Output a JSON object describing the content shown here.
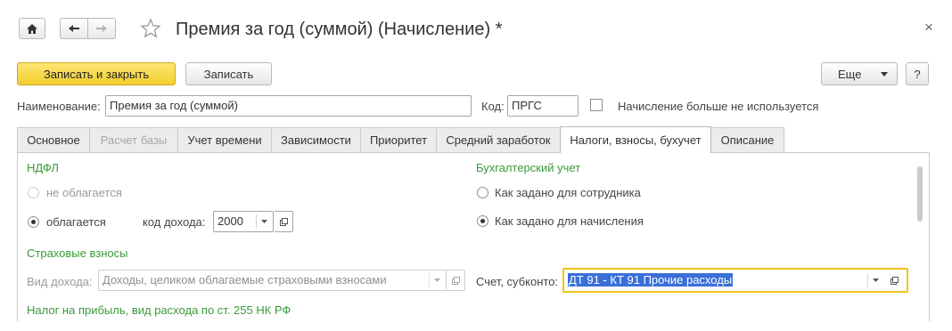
{
  "window": {
    "title": "Премия за год (суммой) (Начисление) *",
    "close_symbol": "×"
  },
  "toolbar": {
    "save_close_label": "Записать и закрыть",
    "save_label": "Записать",
    "more_label": "Еще",
    "help_label": "?"
  },
  "header": {
    "name_label": "Наименование:",
    "name_value": "Премия за год (суммой)",
    "code_label": "Код:",
    "code_value": "ПРГС",
    "not_used_label": "Начисление больше не используется",
    "not_used_checked": false
  },
  "tabs": [
    {
      "label": "Основное",
      "state": "normal"
    },
    {
      "label": "Расчет базы",
      "state": "disabled"
    },
    {
      "label": "Учет времени",
      "state": "normal"
    },
    {
      "label": "Зависимости",
      "state": "normal"
    },
    {
      "label": "Приоритет",
      "state": "normal"
    },
    {
      "label": "Средний заработок",
      "state": "normal"
    },
    {
      "label": "Налоги, взносы, бухучет",
      "state": "active"
    },
    {
      "label": "Описание",
      "state": "normal"
    }
  ],
  "ndfl": {
    "section_title": "НДФЛ",
    "option_not_taxed": "не облагается",
    "option_taxed": "облагается",
    "income_code_label": "код дохода:",
    "income_code_value": "2000",
    "selected": "облагается"
  },
  "insurance": {
    "section_title": "Страховые взносы",
    "income_type_label": "Вид дохода:",
    "income_type_value": "Доходы, целиком облагаемые страховыми взносами"
  },
  "profit_tax": {
    "section_title": "Налог на прибыль, вид расхода по ст. 255 НК РФ"
  },
  "accounting": {
    "section_title": "Бухгалтерский учет",
    "option_employee": "Как задано для сотрудника",
    "option_accrual": "Как задано для начисления",
    "selected": "Как задано для начисления",
    "account_label": "Счет, субконто:",
    "account_value": "ДТ 91 - КТ 91  Прочие расходы"
  },
  "colors": {
    "accent_yellow": "#f3ce2c",
    "section_green": "#3b9a3b",
    "focus_border": "#f0c419",
    "selection_blue": "#3a6fd8"
  }
}
